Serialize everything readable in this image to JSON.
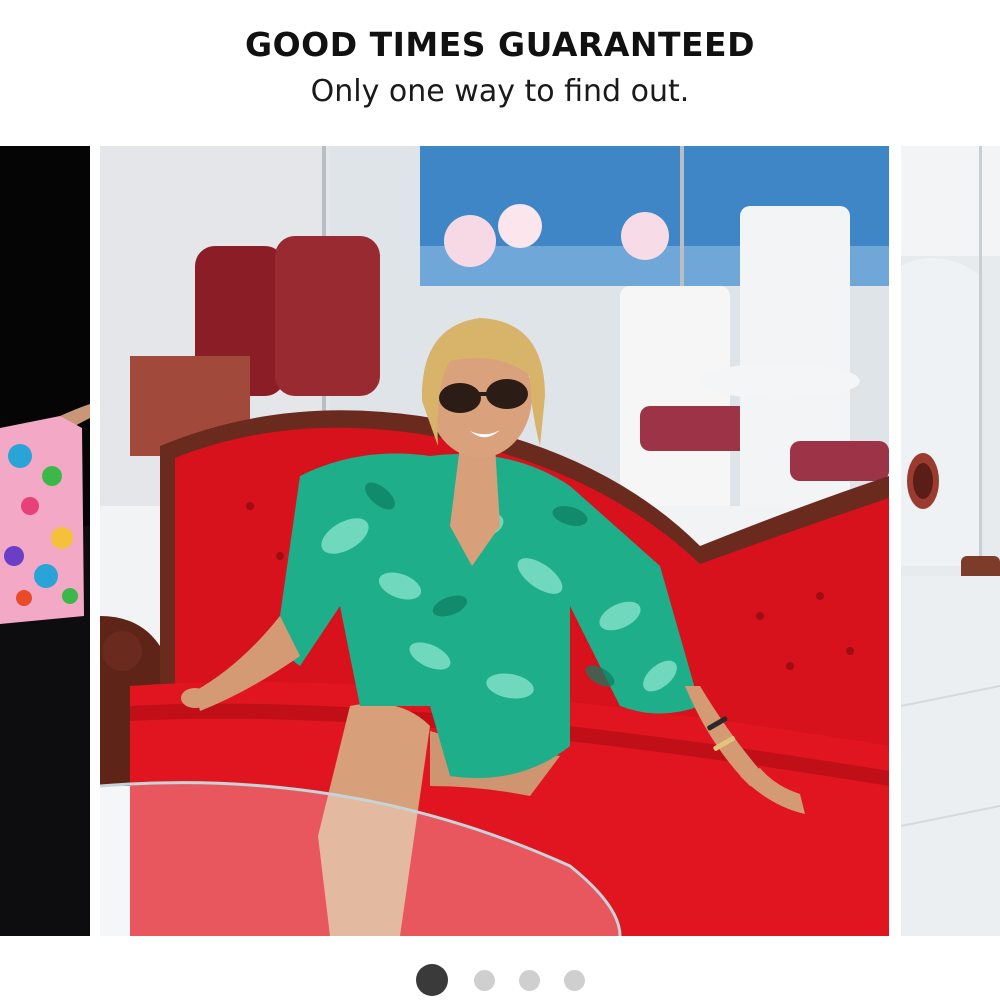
{
  "promo": {
    "headline": "GOOD TIMES GUARANTEED",
    "subline": "Only one way to find out."
  },
  "carousel": {
    "slides": [
      {
        "state": "previous",
        "content": "model in pink floral kimono"
      },
      {
        "state": "current",
        "content": "woman in green tropical print kimono on red velvet sofa"
      },
      {
        "state": "next",
        "content": "white interior with glass wall"
      }
    ],
    "dots": [
      {
        "state": "active"
      },
      {
        "state": "inactive"
      },
      {
        "state": "inactive"
      },
      {
        "state": "inactive"
      }
    ],
    "active_index": 0
  },
  "colors": {
    "sofa_red": "#e0141e",
    "kimono_green": "#1fae8a",
    "dot_active": "#3a3a3a",
    "dot_inactive": "#cfcfcf"
  }
}
